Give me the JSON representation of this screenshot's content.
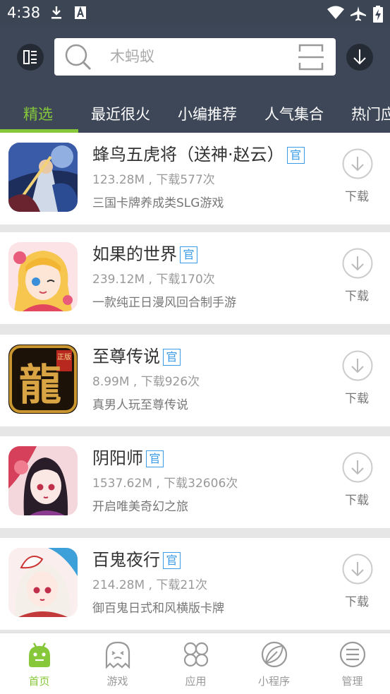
{
  "status_bar": {
    "time": "4:38"
  },
  "search": {
    "placeholder": "木蚂蚁"
  },
  "tabs": [
    {
      "label": "精选",
      "active": true
    },
    {
      "label": "最近很火"
    },
    {
      "label": "小编推荐"
    },
    {
      "label": "人气集合"
    },
    {
      "label": "热门应"
    }
  ],
  "apps": [
    {
      "title": "蜂鸟五虎将（送神·赵云）",
      "badge": "官",
      "meta": "123.28M , 下载577次",
      "desc": "三国卡牌养成类SLG游戏",
      "download_label": "下载"
    },
    {
      "title": "如果的世界",
      "badge": "官",
      "meta": "239.12M , 下载170次",
      "desc": "一款纯正日漫风回合制手游",
      "download_label": "下载"
    },
    {
      "title": "至尊传说",
      "badge": "官",
      "meta": "8.99M , 下载926次",
      "desc": "真男人玩至尊传说",
      "download_label": "下载",
      "icon_text": "龍",
      "icon_stamp": "正版"
    },
    {
      "title": "阴阳师",
      "badge": "官",
      "meta": "1537.62M , 下载32606次",
      "desc": "开启唯美奇幻之旅",
      "download_label": "下载"
    },
    {
      "title": "百鬼夜行",
      "badge": "官",
      "meta": "214.28M , 下载21次",
      "desc": "御百鬼日式和风横版卡牌",
      "download_label": "下载"
    }
  ],
  "bottom_nav": [
    {
      "label": "首页",
      "icon": "android-robot-icon",
      "active": true
    },
    {
      "label": "游戏",
      "icon": "ghost-icon"
    },
    {
      "label": "应用",
      "icon": "four-circles-icon"
    },
    {
      "label": "小程序",
      "icon": "leaf-icon"
    },
    {
      "label": "管理",
      "icon": "menu-lines-icon"
    }
  ],
  "colors": {
    "header_bg": "#3d4757",
    "accent_green": "#86c83a",
    "badge_blue": "#3a9be6"
  }
}
